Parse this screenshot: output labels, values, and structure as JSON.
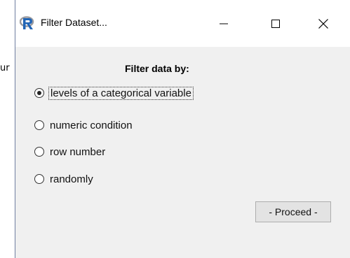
{
  "background": {
    "fragment_text": "ur"
  },
  "window": {
    "title": "Filter Dataset...",
    "app_icon": "r-logo-icon",
    "controls": {
      "minimize_icon": "minimize-icon",
      "maximize_icon": "maximize-icon",
      "close_icon": "close-icon"
    }
  },
  "panel": {
    "heading": "Filter data by:",
    "options": [
      {
        "label": "levels of a categorical variable",
        "selected": true
      },
      {
        "label": "numeric condition",
        "selected": false
      },
      {
        "label": "row number",
        "selected": false
      },
      {
        "label": "randomly",
        "selected": false
      }
    ],
    "proceed_label": "- Proceed -"
  },
  "colors": {
    "window_bg": "#f0f0f0",
    "titlebar_bg": "#ffffff",
    "r_logo_blue": "#2165b6",
    "r_logo_gray": "#9a9ba0"
  }
}
